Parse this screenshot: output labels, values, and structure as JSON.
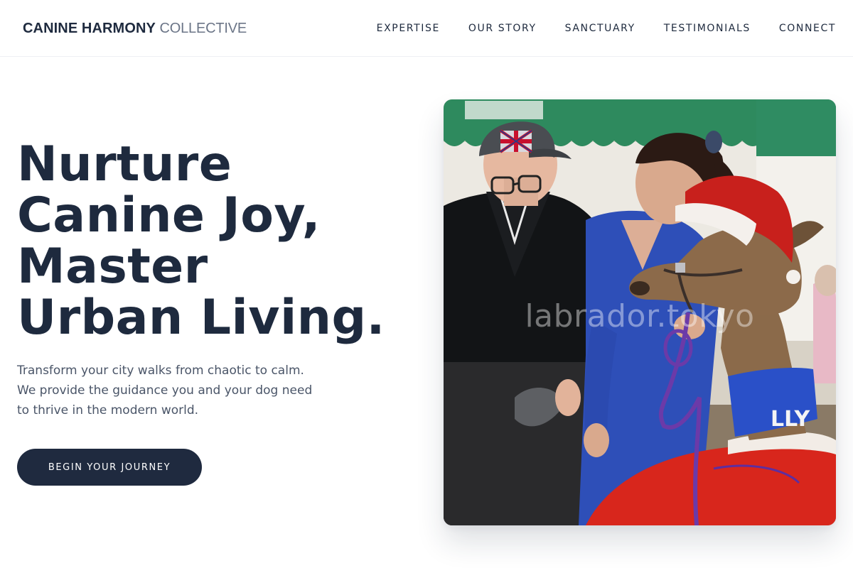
{
  "brand": {
    "name_strong": "CANINE HARMONY",
    "name_light": "COLLECTIVE"
  },
  "nav": {
    "items": [
      {
        "label": "EXPERTISE"
      },
      {
        "label": "OUR STORY"
      },
      {
        "label": "SANCTUARY"
      },
      {
        "label": "TESTIMONIALS"
      },
      {
        "label": "CONNECT"
      }
    ]
  },
  "hero": {
    "title_lines": [
      "Nurture",
      "Canine Joy,",
      "Master",
      "Urban Living."
    ],
    "subtitle_lines": [
      "Transform your city walks from chaotic to calm.",
      "We provide the guidance you and your dog need",
      "to thrive in the modern world."
    ],
    "cta_label": "BEGIN YOUR JOURNEY",
    "image": {
      "watermark": "labrador.tokyo",
      "cap_badge": "ENGLAND",
      "scarf_text": "LLY"
    }
  },
  "colors": {
    "primary": "#1e2a3e",
    "muted": "#6b7587",
    "body_text": "#4a5568",
    "cta_bg": "#1f2a3f",
    "cta_text": "#ffffff",
    "background": "#ffffff"
  }
}
